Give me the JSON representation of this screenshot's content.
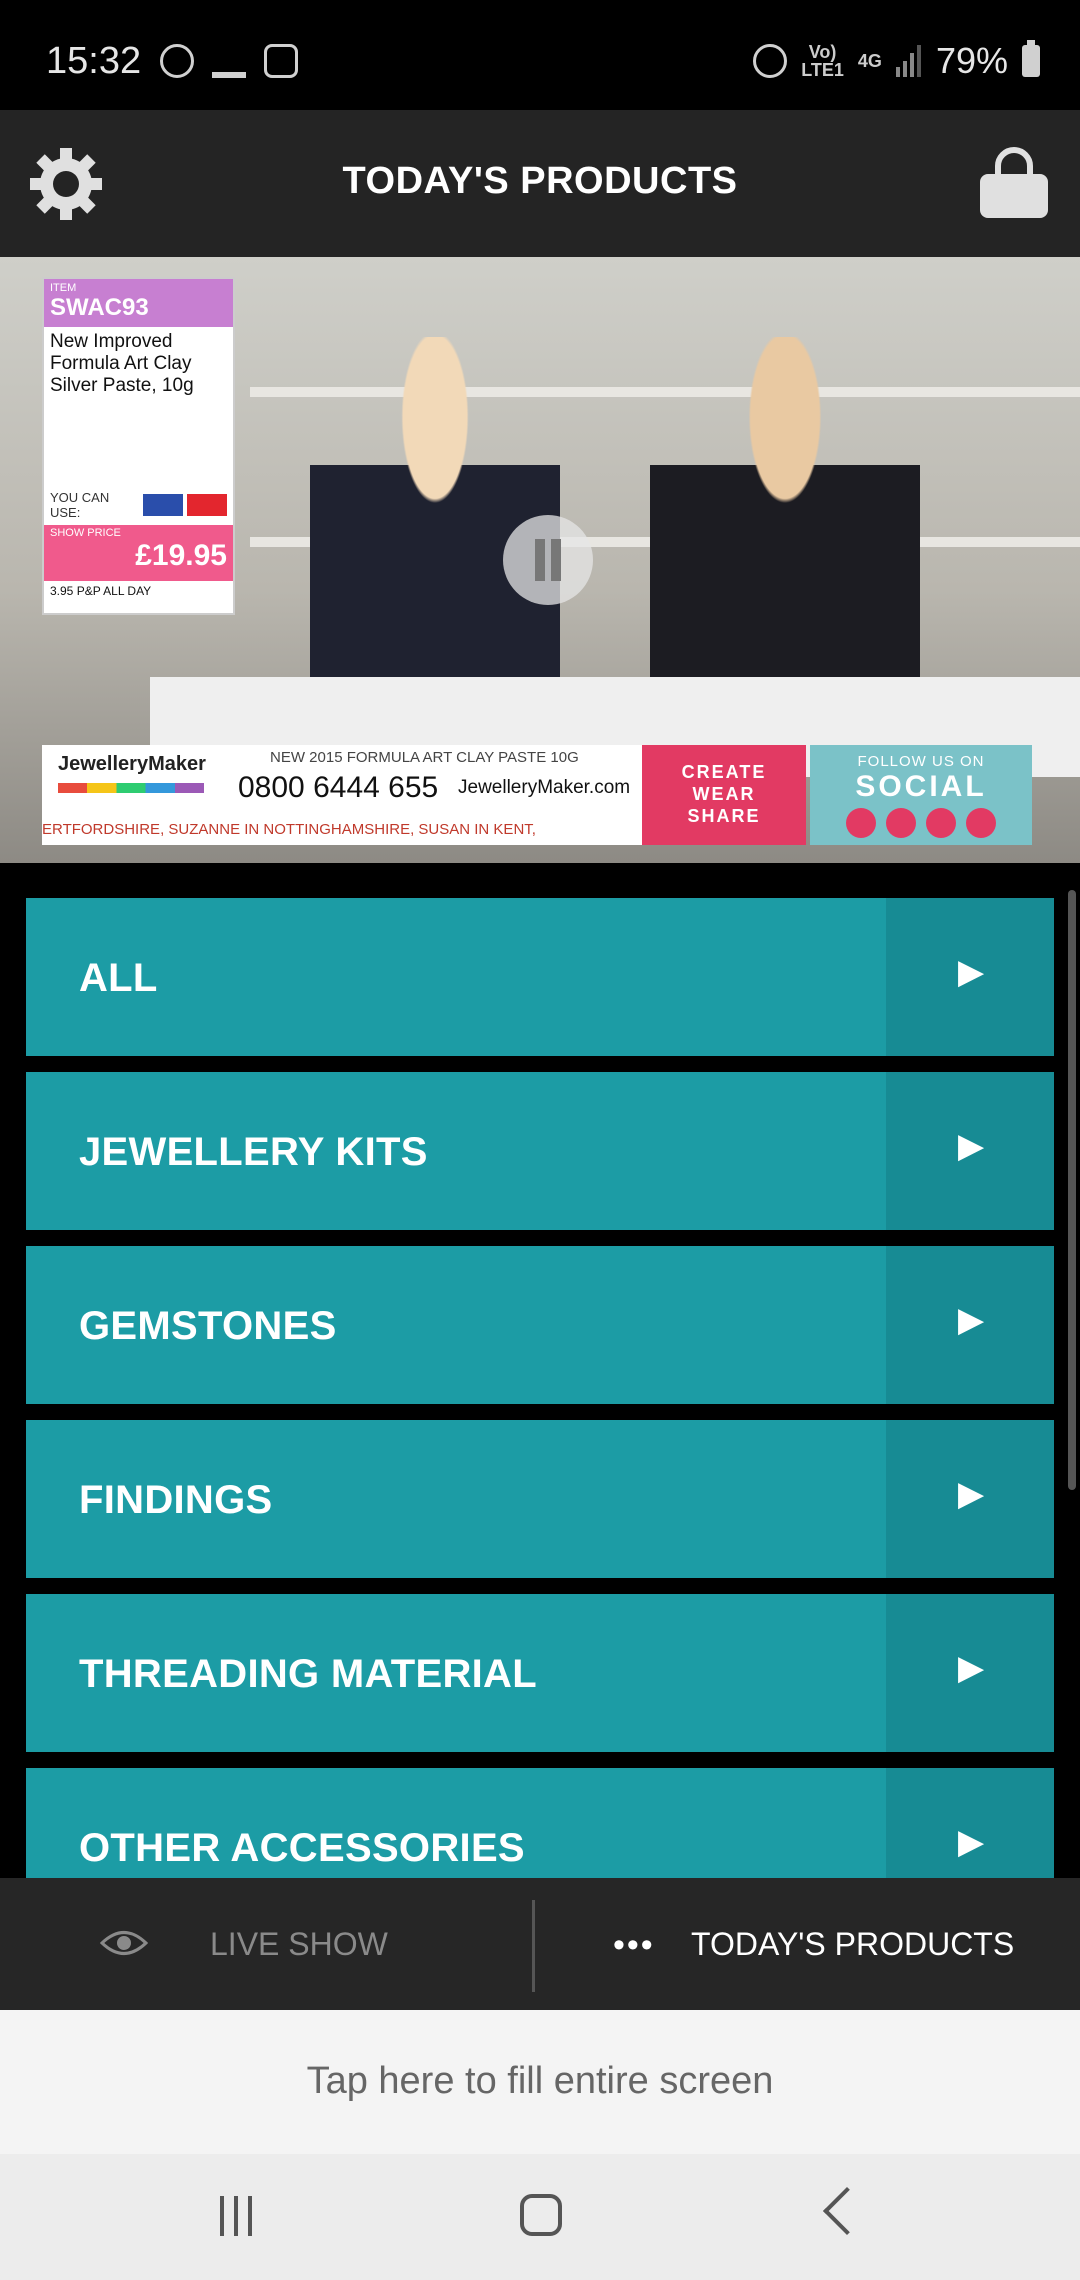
{
  "status_bar": {
    "time": "15:32",
    "network_top": "Vo)",
    "network_bottom": "LTE1",
    "data_type": "4G",
    "battery": "79%"
  },
  "header": {
    "title": "TODAY'S PRODUCTS"
  },
  "video": {
    "item_label": "ITEM",
    "item_code": "SWAC93",
    "item_description": "New Improved Formula Art Clay Silver Paste, 10g",
    "payment_label": "YOU CAN USE:",
    "show_price_label": "SHOW PRICE",
    "show_price": "£19.95",
    "pp_note": "3.95 P&P ALL DAY",
    "ticker_brand": "JewelleryMaker",
    "ticker_product": "NEW 2015 FORMULA ART CLAY PASTE 10G",
    "ticker_phone": "0800 6444 655",
    "ticker_site": "JewelleryMaker.com",
    "ticker_scroll": "ERTFORDSHIRE, SUZANNE IN NOTTINGHAMSHIRE, SUSAN IN KENT,",
    "cws_line1": "CREATE",
    "cws_line2": "WEAR",
    "cws_line3": "SHARE",
    "follow_text": "FOLLOW US ON",
    "social_text": "SOCIAL"
  },
  "categories": [
    {
      "label": "ALL"
    },
    {
      "label": "JEWELLERY KITS"
    },
    {
      "label": "GEMSTONES"
    },
    {
      "label": "FINDINGS"
    },
    {
      "label": "THREADING MATERIAL"
    },
    {
      "label": "OTHER ACCESSORIES"
    }
  ],
  "arrow_glyph": "▶",
  "bottom_tabs": {
    "live_show": "LIVE SHOW",
    "todays_products": "TODAY'S PRODUCTS",
    "dots": "•••"
  },
  "fill_screen_text": "Tap here to fill entire screen",
  "colors": {
    "category_bg": "#1c9ca5",
    "category_arrow_bg": "#178b94",
    "header_bg": "#242424"
  }
}
